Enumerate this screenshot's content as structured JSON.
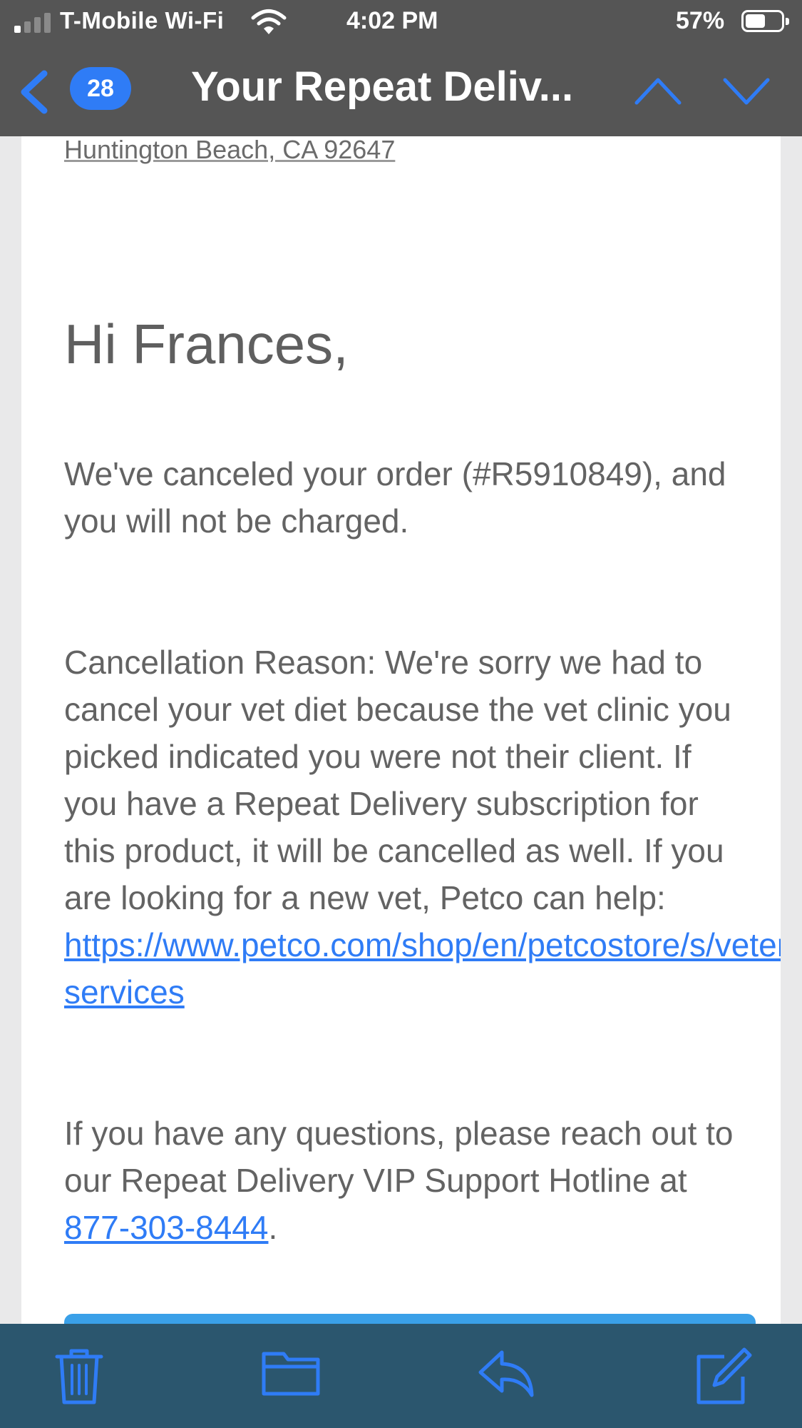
{
  "status_bar": {
    "carrier": "T-Mobile Wi-Fi",
    "time": "4:02 PM",
    "battery_percent": "57%",
    "battery_level": 0.57,
    "signal_bars": 1
  },
  "nav": {
    "unread_count": "28",
    "subject": "Your Repeat Deliv..."
  },
  "email": {
    "address_line": "Huntington Beach, CA 92647",
    "greeting": "Hi Frances,",
    "paragraph1": "We've canceled your order (#R5910849), and you will not be charged.",
    "paragraph2_text": "Cancellation Reason: We're sorry we had to cancel your vet diet because the vet clinic you picked indicated you were not their client. If you have a Repeat Delivery subscription for this product, it will be cancelled as well. If you are looking for a new vet, Petco can help: ",
    "paragraph2_link": "https://www.petco.com/shop/en/petcostore/s/veterinary-services",
    "paragraph3_text": "If you have any questions, please reach out to our Repeat Delivery VIP Support Hotline at ",
    "phone_link": "877-303-8444",
    "paragraph3_end": "."
  },
  "toolbar": {
    "icons": [
      "trash-icon",
      "folder-icon",
      "reply-icon",
      "compose-icon"
    ]
  },
  "colors": {
    "nav_background": "#555555",
    "toolbar_background": "#2b566e",
    "accent": "#2f7cf6",
    "body_text": "#636363"
  }
}
